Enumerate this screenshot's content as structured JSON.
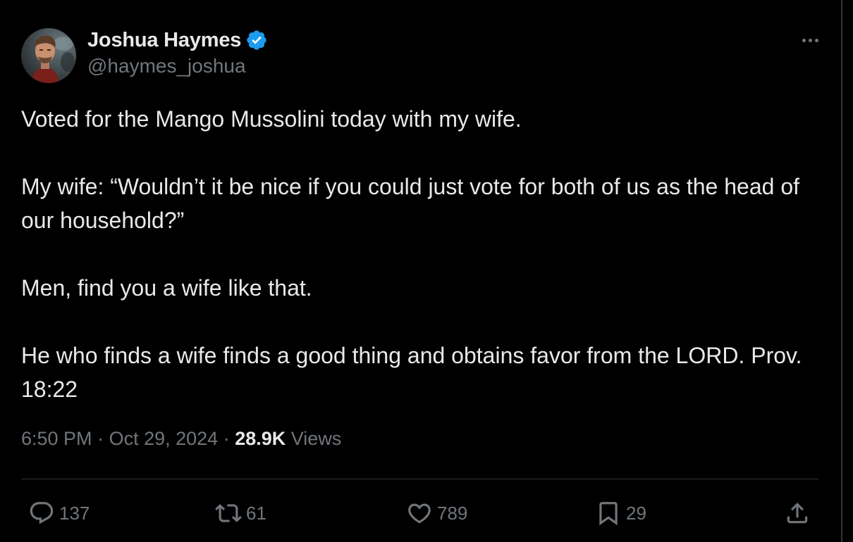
{
  "author": {
    "display_name": "Joshua Haymes",
    "handle": "@haymes_joshua",
    "verified": true,
    "verified_color": "#1d9bf0"
  },
  "tweet": {
    "paragraphs": [
      "Voted for the Mango Mussolini today with my wife.",
      "My wife: “Wouldn’t it be nice if you could just vote for both of us as the head of our household?”",
      "Men, find you a wife like that.",
      "He who finds a wife finds a good thing and obtains favor from the LORD. Prov. 18:22"
    ],
    "time": "6:50 PM",
    "date": "Oct 29, 2024",
    "views_count": "28.9K",
    "views_label": "Views"
  },
  "actions": {
    "reply_count": "137",
    "retweet_count": "61",
    "like_count": "789",
    "bookmark_count": "29"
  },
  "icons": {
    "more": "more-horizontal-icon",
    "reply": "reply-icon",
    "retweet": "retweet-icon",
    "like": "heart-icon",
    "bookmark": "bookmark-icon",
    "share": "share-icon"
  },
  "colors": {
    "background": "#000000",
    "text_primary": "#e7e9ea",
    "text_secondary": "#71767b",
    "divider": "#2f3336"
  }
}
